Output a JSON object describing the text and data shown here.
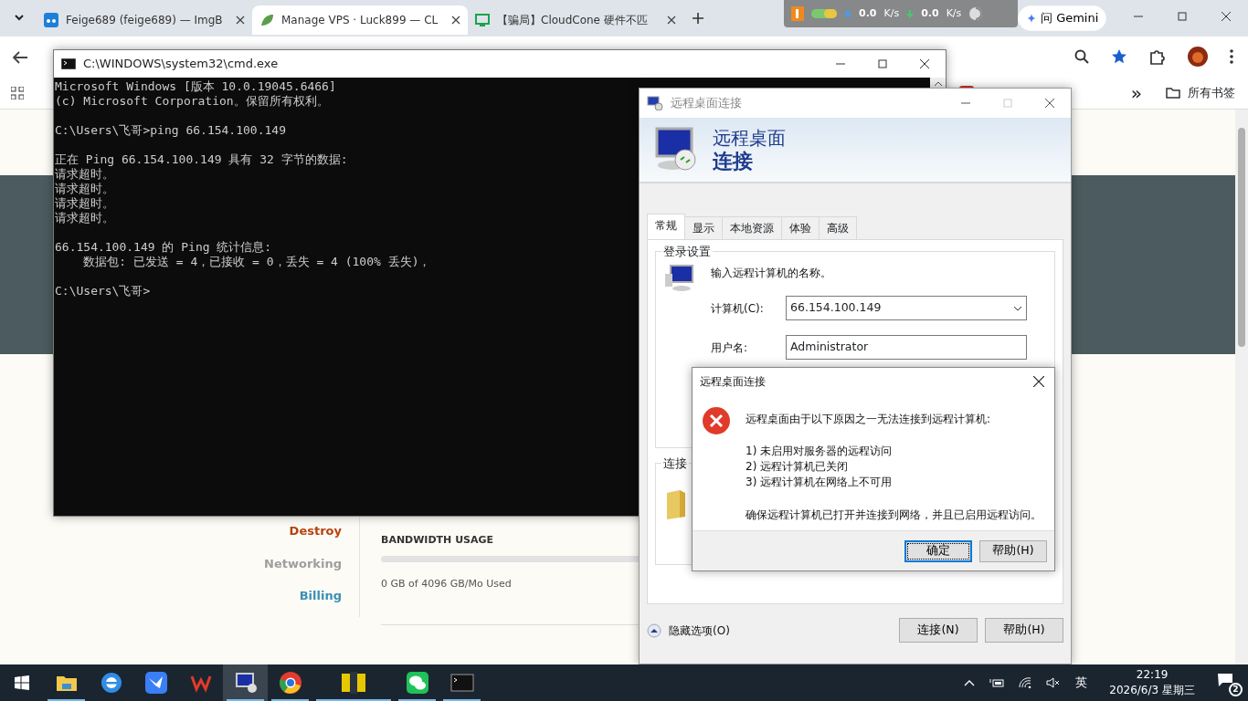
{
  "browser": {
    "tabs": [
      {
        "title": "Feige689 (feige689) — ImgB",
        "kind": "imgbb",
        "selected": false
      },
      {
        "title": "Manage VPS · Luck899 — CL",
        "kind": "leaf",
        "selected": true
      },
      {
        "title": "【骗局】CloudCone 硬件不匹",
        "kind": "monitor",
        "selected": false
      }
    ],
    "gemini": "问 Gemini",
    "speeds": [
      {
        "kind": "up",
        "value": "0.0",
        "unit": "K/s"
      },
      {
        "kind": "down",
        "value": "0.0",
        "unit": "K/s"
      }
    ],
    "bookmarks_more": "»",
    "all_bookmarks": "所有书签"
  },
  "page": {
    "menu": [
      {
        "label": "Destroy",
        "color": "#b7410e"
      },
      {
        "label": "Networking",
        "color": "#9e9e9e"
      },
      {
        "label": "Billing",
        "color": "#3b8fb5"
      }
    ],
    "bandwidth": {
      "title": "BANDWIDTH USAGE",
      "level": 0,
      "caption": "0 GB of 4096 GB/Mo Used"
    }
  },
  "cmd": {
    "title": "C:\\WINDOWS\\system32\\cmd.exe",
    "blocks": [
      [
        "Microsoft Windows [版本 10.0.19045.6466]",
        "(c) Microsoft Corporation。保留所有权利。"
      ],
      [
        "C:\\Users\\飞哥>ping 66.154.100.149"
      ],
      [
        "正在 Ping 66.154.100.149 具有 32 字节的数据:",
        "请求超时。",
        "请求超时。",
        "请求超时。",
        "请求超时。"
      ],
      [
        "66.154.100.149 的 Ping 统计信息:",
        "    数据包: 已发送 = 4，已接收 = 0，丢失 = 4 (100% 丢失)，"
      ],
      [
        "C:\\Users\\飞哥>"
      ]
    ]
  },
  "rdp": {
    "title": "远程桌面连接",
    "heading": "远程桌面",
    "subheading": "连接",
    "tabs": [
      {
        "label": "常规",
        "selected": true
      },
      {
        "label": "显示",
        "selected": false
      },
      {
        "label": "本地资源",
        "selected": false
      },
      {
        "label": "体验",
        "selected": false
      },
      {
        "label": "高级",
        "selected": false
      }
    ],
    "login_group": "登录设置",
    "prompt": "输入远程计算机的名称。",
    "computer": {
      "label": "计算机(C):",
      "value": "66.154.100.149"
    },
    "user": {
      "label": "用户名:",
      "value": "Administrator"
    },
    "conn_group": "连接",
    "hide_options": "隐藏选项(O)",
    "buttons": [
      "连接(N)",
      "帮助(H)"
    ]
  },
  "error": {
    "title": "远程桌面连接",
    "message": "远程桌面由于以下原因之一无法连接到远程计算机:",
    "reasons": [
      "1) 未启用对服务器的远程访问",
      "2) 远程计算机已关闭",
      "3) 远程计算机在网络上不可用"
    ],
    "advice": "确保远程计算机已打开并连接到网络，并且已启用远程访问。",
    "buttons": [
      {
        "label": "确定",
        "selected": true
      },
      {
        "label": "帮助(H)",
        "selected": false
      }
    ]
  },
  "taskbar": {
    "apps": [
      {
        "kind": "folder",
        "running": true,
        "selected": false
      },
      {
        "kind": "ie",
        "running": false,
        "selected": false
      },
      {
        "kind": "bird",
        "running": false,
        "selected": false
      },
      {
        "kind": "wps",
        "running": false,
        "selected": false
      },
      {
        "kind": "rdp",
        "running": true,
        "selected": true
      },
      {
        "kind": "chrome",
        "running": true,
        "selected": false
      },
      {
        "kind": "pixel",
        "running": true,
        "selected": false
      },
      {
        "kind": "wechat",
        "running": true,
        "selected": false
      },
      {
        "kind": "cmd",
        "running": true,
        "selected": false
      }
    ],
    "ime": "英",
    "time": "22:19",
    "date": "2026/6/3 星期三",
    "notifications": "2"
  }
}
